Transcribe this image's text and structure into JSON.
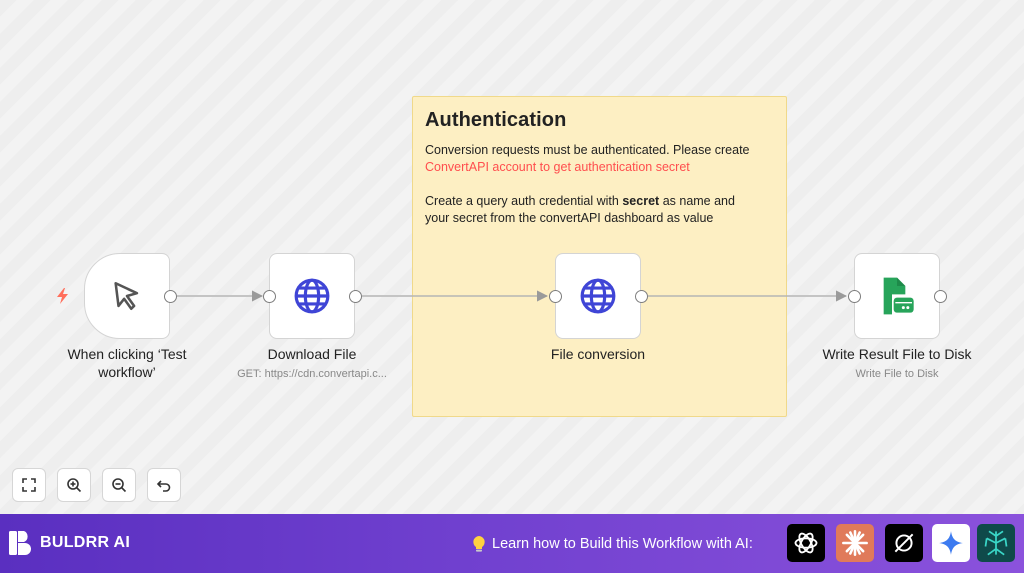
{
  "sticky_note": {
    "title": "Authentication",
    "line1": "Conversion requests must be authenticated. Please create",
    "link_text": "ConvertAPI account to get authentication secret",
    "line2_prefix": "Create a query auth credential with",
    "line2_bold": "secret",
    "line2_suffix": "as name and",
    "line3": "your secret from the convertAPI dashboard as value"
  },
  "nodes": [
    {
      "label": "When clicking ‘Test workflow’",
      "sublabel": "",
      "icon": "cursor-icon"
    },
    {
      "label": "Download File",
      "sublabel": "GET: https://cdn.convertapi.c...",
      "icon": "globe-icon"
    },
    {
      "label": "File conversion",
      "sublabel": "",
      "icon": "globe-icon"
    },
    {
      "label": "Write Result File to Disk",
      "sublabel": "Write File to Disk",
      "icon": "file-disk-icon"
    }
  ],
  "toolbar": [
    {
      "icon": "fit-view-icon"
    },
    {
      "icon": "zoom-in-icon"
    },
    {
      "icon": "zoom-out-icon"
    },
    {
      "icon": "undo-icon"
    }
  ],
  "footer": {
    "brand": "BULDRR AI",
    "learn_text": "Learn how to Build this Workflow with AI:",
    "ai_buttons": [
      "chatgpt-icon",
      "claude-icon",
      "perplexity-icon",
      "gemini-icon",
      "deepseek-icon"
    ]
  },
  "colors": {
    "accent_globe": "#3f45d6",
    "trigger_bolt": "#ff6f5c",
    "file_icon": "#27a45a",
    "footer_start": "#5a2fc0",
    "footer_end": "#8b52dc",
    "sticky_bg": "#fdefc3",
    "link": "#ff4e4e"
  }
}
